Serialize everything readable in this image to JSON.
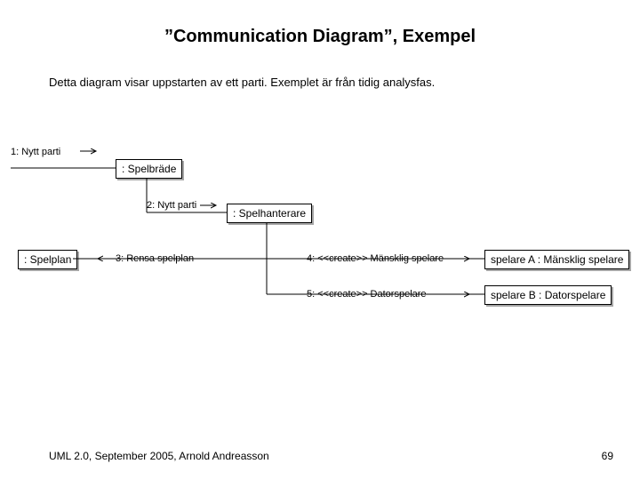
{
  "title": "”Communication Diagram”, Exempel",
  "subtitle": "Detta diagram visar uppstarten av ett parti. Exemplet är från tidig analysfas.",
  "boxes": {
    "spelbrade": ": Spelbräde",
    "spelhanterare": ": Spelhanterare",
    "spelplan": ": Spelplan",
    "spelareA": "spelare A : Mänsklig spelare",
    "spelareB": "spelare B : Datorspelare"
  },
  "messages": {
    "m1": "1: Nytt parti",
    "m2": "2: Nytt parti",
    "m3": "3: Rensa spelplan",
    "m4": "4: <<create>> Mänsklig spelare",
    "m5": "5: <<create>> Datorspelare"
  },
  "footer": {
    "left": "UML 2.0, September 2005, Arnold Andreasson",
    "right": "69"
  }
}
